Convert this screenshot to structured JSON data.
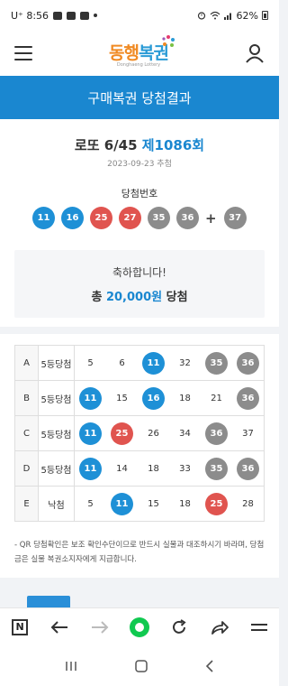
{
  "status_bar": {
    "time": "U⁺ 8:56",
    "battery": "62%"
  },
  "header": {
    "logo_part1": "동행",
    "logo_part2": "복권",
    "logo_sub": "Donghaeng Lottery"
  },
  "page_title": "구매복권 당첨결과",
  "draw": {
    "game": "로또 6/45",
    "round": "제1086회",
    "date": "2023-09-23 추첨",
    "win_label": "당첨번호",
    "winning_numbers": [
      {
        "num": "11",
        "color": "blue"
      },
      {
        "num": "16",
        "color": "blue"
      },
      {
        "num": "25",
        "color": "red"
      },
      {
        "num": "27",
        "color": "red"
      },
      {
        "num": "35",
        "color": "gray"
      },
      {
        "num": "36",
        "color": "gray"
      }
    ],
    "plus": "+",
    "bonus": {
      "num": "37",
      "color": "gray"
    }
  },
  "congrats": {
    "message": "축하합니다!",
    "prefix": "총",
    "amount": "20,000원",
    "suffix": "당첨"
  },
  "tickets": [
    {
      "game": "A",
      "result": "5등당첨",
      "numbers": [
        {
          "num": "5",
          "hit": ""
        },
        {
          "num": "6",
          "hit": ""
        },
        {
          "num": "11",
          "hit": "blue"
        },
        {
          "num": "32",
          "hit": ""
        },
        {
          "num": "35",
          "hit": "gray"
        },
        {
          "num": "36",
          "hit": "gray"
        }
      ]
    },
    {
      "game": "B",
      "result": "5등당첨",
      "numbers": [
        {
          "num": "11",
          "hit": "blue"
        },
        {
          "num": "15",
          "hit": ""
        },
        {
          "num": "16",
          "hit": "blue"
        },
        {
          "num": "18",
          "hit": ""
        },
        {
          "num": "21",
          "hit": ""
        },
        {
          "num": "36",
          "hit": "gray"
        }
      ]
    },
    {
      "game": "C",
      "result": "5등당첨",
      "numbers": [
        {
          "num": "11",
          "hit": "blue"
        },
        {
          "num": "25",
          "hit": "red"
        },
        {
          "num": "26",
          "hit": ""
        },
        {
          "num": "34",
          "hit": ""
        },
        {
          "num": "36",
          "hit": "gray"
        },
        {
          "num": "37",
          "hit": ""
        }
      ]
    },
    {
      "game": "D",
      "result": "5등당첨",
      "numbers": [
        {
          "num": "11",
          "hit": "blue"
        },
        {
          "num": "14",
          "hit": ""
        },
        {
          "num": "18",
          "hit": ""
        },
        {
          "num": "33",
          "hit": ""
        },
        {
          "num": "35",
          "hit": "gray"
        },
        {
          "num": "36",
          "hit": "gray"
        }
      ]
    },
    {
      "game": "E",
      "result": "낙첨",
      "numbers": [
        {
          "num": "5",
          "hit": ""
        },
        {
          "num": "11",
          "hit": "blue"
        },
        {
          "num": "15",
          "hit": ""
        },
        {
          "num": "18",
          "hit": ""
        },
        {
          "num": "25",
          "hit": "red"
        },
        {
          "num": "28",
          "hit": ""
        }
      ]
    }
  ],
  "notice": "- QR 당첨확인은 보조 확인수단이므로 반드시 실물과 대조하시기 바라며, 당첨금은 실물 복권소지자에게 지급합니다.",
  "colors": {
    "blue": "#1e90d6",
    "red": "#e0544f",
    "gray": "#8c8c8c",
    "title_band": "#1a87d0",
    "browser_home": "#10c950"
  }
}
